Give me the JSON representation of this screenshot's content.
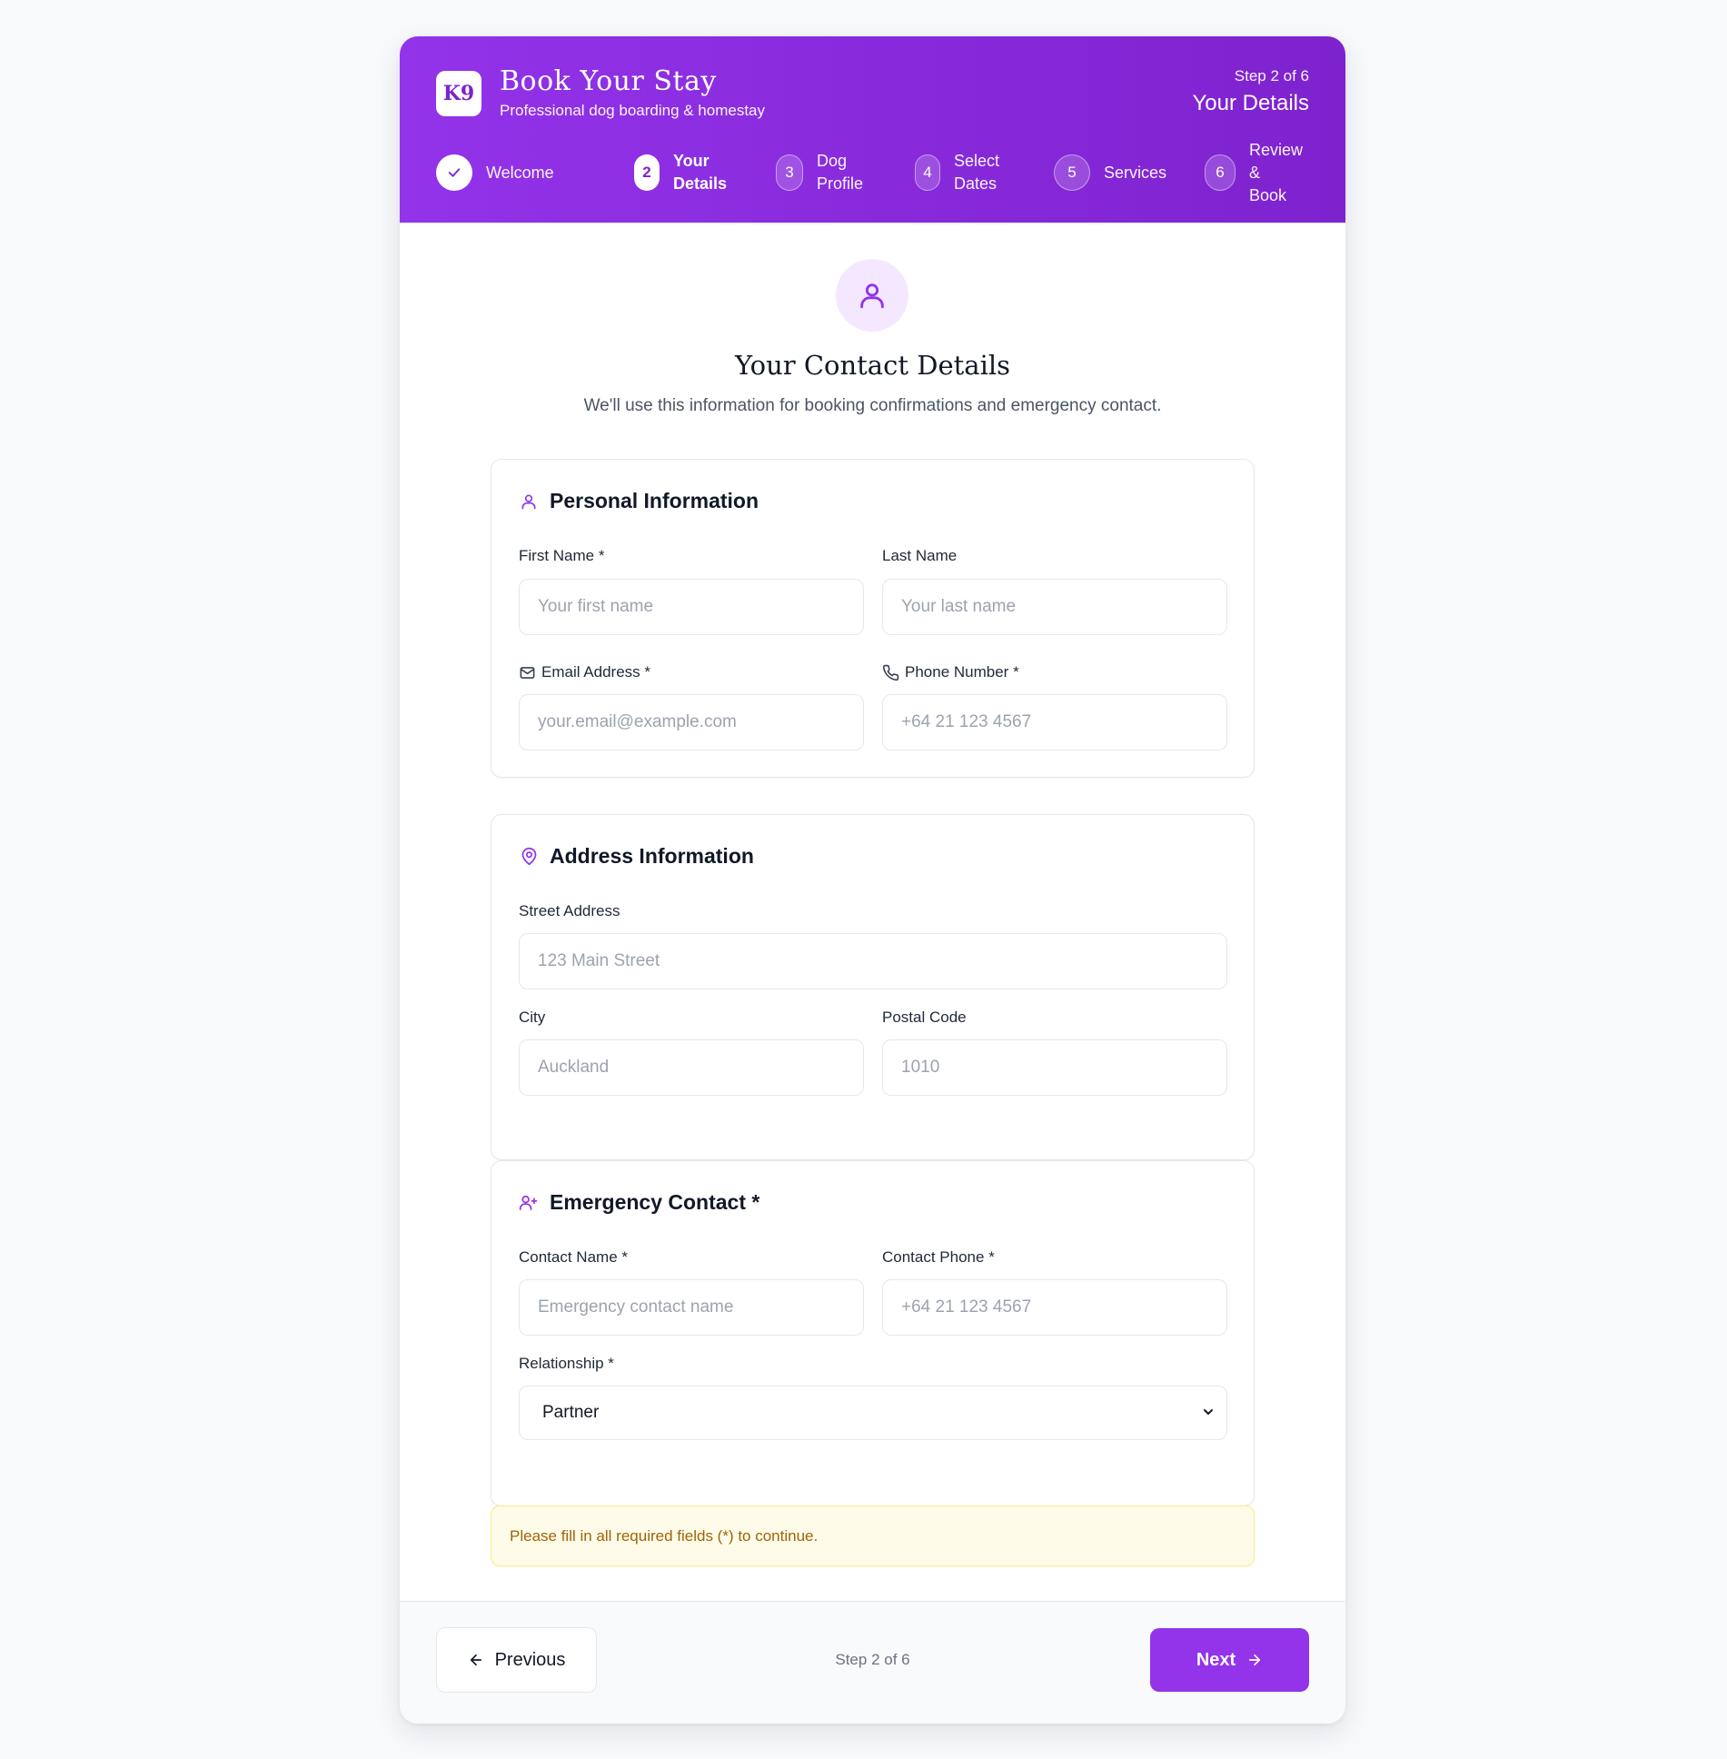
{
  "header": {
    "logo_text": "K9",
    "title": "Book Your Stay",
    "subtitle": "Professional dog boarding & homestay",
    "step_count": "Step 2 of 6",
    "step_name": "Your Details"
  },
  "steps": [
    {
      "number": "",
      "label_line1": "Welcome",
      "label_line2": "",
      "state": "completed"
    },
    {
      "number": "2",
      "label_line1": "Your",
      "label_line2": "Details",
      "state": "active"
    },
    {
      "number": "3",
      "label_line1": "Dog",
      "label_line2": "Profile",
      "state": "upcoming"
    },
    {
      "number": "4",
      "label_line1": "Select",
      "label_line2": "Dates",
      "state": "upcoming"
    },
    {
      "number": "5",
      "label_line1": "Services",
      "label_line2": "",
      "state": "upcoming"
    },
    {
      "number": "6",
      "label_line1": "Review &",
      "label_line2": "Book",
      "state": "upcoming"
    }
  ],
  "hero": {
    "icon": "user-icon",
    "title": "Your Contact Details",
    "subtitle": "We'll use this information for booking confirmations and emergency contact."
  },
  "personal": {
    "icon": "user-icon",
    "title": "Personal Information",
    "first_name": {
      "label": "First Name *",
      "placeholder": "Your first name",
      "value": ""
    },
    "last_name": {
      "label": "Last Name",
      "placeholder": "Your last name",
      "value": ""
    },
    "email": {
      "icon": "mail-icon",
      "label": "Email Address *",
      "placeholder": "your.email@example.com",
      "value": ""
    },
    "phone": {
      "icon": "phone-icon",
      "label": "Phone Number *",
      "placeholder": "+64 21 123 4567",
      "value": ""
    }
  },
  "address": {
    "icon": "map-pin-icon",
    "title": "Address Information",
    "street": {
      "label": "Street Address",
      "placeholder": "123 Main Street",
      "value": ""
    },
    "city": {
      "label": "City",
      "placeholder": "Auckland",
      "value": ""
    },
    "postal": {
      "label": "Postal Code",
      "placeholder": "1010",
      "value": ""
    }
  },
  "emergency": {
    "icon": "user-plus-icon",
    "title": "Emergency Contact *",
    "contact_name": {
      "label": "Contact Name *",
      "placeholder": "Emergency contact name",
      "value": ""
    },
    "contact_phone": {
      "label": "Contact Phone *",
      "placeholder": "+64 21 123 4567",
      "value": ""
    },
    "relationship": {
      "label": "Relationship *",
      "value": "Partner"
    }
  },
  "notice": "Please fill in all required fields (*) to continue.",
  "footer": {
    "prev_label": "Previous",
    "step_count": "Step 2 of 6",
    "next_label": "Next"
  },
  "colors": {
    "brand": "#9333ea",
    "brand_dark": "#7e22ce",
    "notice_bg": "#fefce8",
    "notice_text": "#a16207"
  }
}
